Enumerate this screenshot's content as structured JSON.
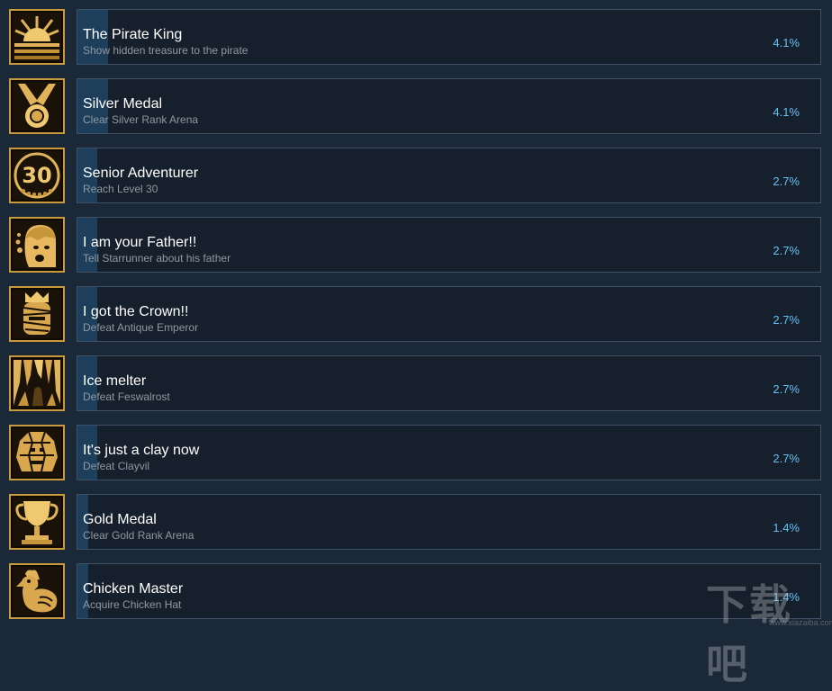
{
  "achievements": [
    {
      "title": "The Pirate King",
      "description": "Show hidden treasure to the pirate",
      "percent": "4.1%",
      "percent_value": 4.1,
      "icon": "sunrise-icon"
    },
    {
      "title": "Silver Medal",
      "description": "Clear Silver Rank Arena",
      "percent": "4.1%",
      "percent_value": 4.1,
      "icon": "medal-icon"
    },
    {
      "title": "Senior Adventurer",
      "description": "Reach Level 30",
      "percent": "2.7%",
      "percent_value": 2.7,
      "icon": "level-30-icon"
    },
    {
      "title": "I am your Father!!",
      "description": "Tell Starrunner about his father",
      "percent": "2.7%",
      "percent_value": 2.7,
      "icon": "shocked-face-icon"
    },
    {
      "title": "I got the Crown!!",
      "description": "Defeat Antique Emperor",
      "percent": "2.7%",
      "percent_value": 2.7,
      "icon": "mummy-crown-icon"
    },
    {
      "title": "Ice melter",
      "description": "Defeat Feswalrost",
      "percent": "2.7%",
      "percent_value": 2.7,
      "icon": "ice-cave-icon"
    },
    {
      "title": "It's just a clay now",
      "description": "Defeat Clayvil",
      "percent": "2.7%",
      "percent_value": 2.7,
      "icon": "clay-golem-icon"
    },
    {
      "title": "Gold Medal",
      "description": "Clear Gold Rank Arena",
      "percent": "1.4%",
      "percent_value": 1.4,
      "icon": "trophy-icon"
    },
    {
      "title": "Chicken Master",
      "description": "Acquire Chicken Hat",
      "percent": "1.4%",
      "percent_value": 1.4,
      "icon": "chicken-icon"
    }
  ],
  "icon_text": {
    "level_number": "30"
  },
  "watermark": {
    "main": "下载吧",
    "sub": "www.xiazaiba.com"
  },
  "colors": {
    "background": "#1b2838",
    "bar": "#1e3f5c",
    "percent": "#66c0f4",
    "gold": "#c89a3c"
  }
}
